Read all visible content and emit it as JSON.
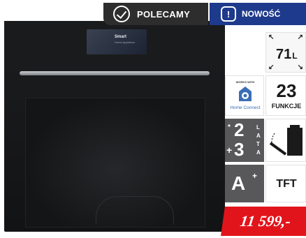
{
  "badges": {
    "recommend": {
      "label": "POLECAMY",
      "icon": "checkmark-circle-icon"
    },
    "new": {
      "label": "NOWOŚĆ",
      "icon": "exclamation-badge-icon"
    }
  },
  "product": {
    "display_brand": "Smart",
    "display_sub": "Home Appliance"
  },
  "features": {
    "capacity": {
      "value": "71",
      "unit": "L"
    },
    "home_connect": {
      "small": "WORKS WITH",
      "label": "Home Connect"
    },
    "functions": {
      "number": "23",
      "label": "FUNKCJE"
    },
    "warranty": {
      "row1_sign": "*",
      "row1_num": "2",
      "row2_sign": "+",
      "row2_num": "3",
      "letters": [
        "L",
        "A",
        "T",
        "A"
      ]
    },
    "energy": {
      "class": "A",
      "plus": "+"
    },
    "display": {
      "label": "TFT"
    }
  },
  "price": {
    "label": "11 599,-"
  },
  "colors": {
    "recommend_badge": "#2d2d2d",
    "new_badge": "#1e3a8c",
    "price_bg": "#e2141b",
    "tile_dark": "#58585a"
  }
}
